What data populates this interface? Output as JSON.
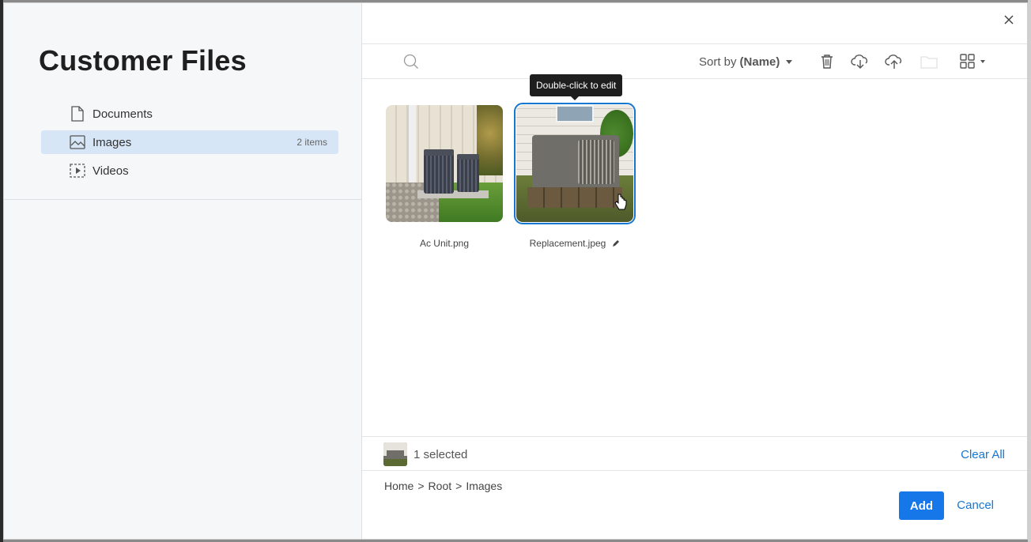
{
  "panel": {
    "title": "Customer Files"
  },
  "nav": {
    "items": [
      {
        "label": "Documents",
        "icon": "document-icon",
        "count": ""
      },
      {
        "label": "Images",
        "icon": "image-icon",
        "count": "2 items",
        "active": true
      },
      {
        "label": "Videos",
        "icon": "video-icon",
        "count": ""
      }
    ]
  },
  "toolbar": {
    "sort_prefix": "Sort by",
    "sort_value": "(Name)"
  },
  "tooltip": {
    "text": "Double-click to edit"
  },
  "files": [
    {
      "name": "Ac Unit.png",
      "selected": false
    },
    {
      "name": "Replacement.jpeg",
      "selected": true
    }
  ],
  "selection": {
    "count_text": "1 selected",
    "clear_label": "Clear All"
  },
  "breadcrumb": [
    "Home",
    "Root",
    "Images"
  ],
  "actions": {
    "add_label": "Add",
    "cancel_label": "Cancel"
  },
  "colors": {
    "accent": "#1677e8",
    "active_nav_bg": "#d6e6f7",
    "link": "#1677d2"
  }
}
